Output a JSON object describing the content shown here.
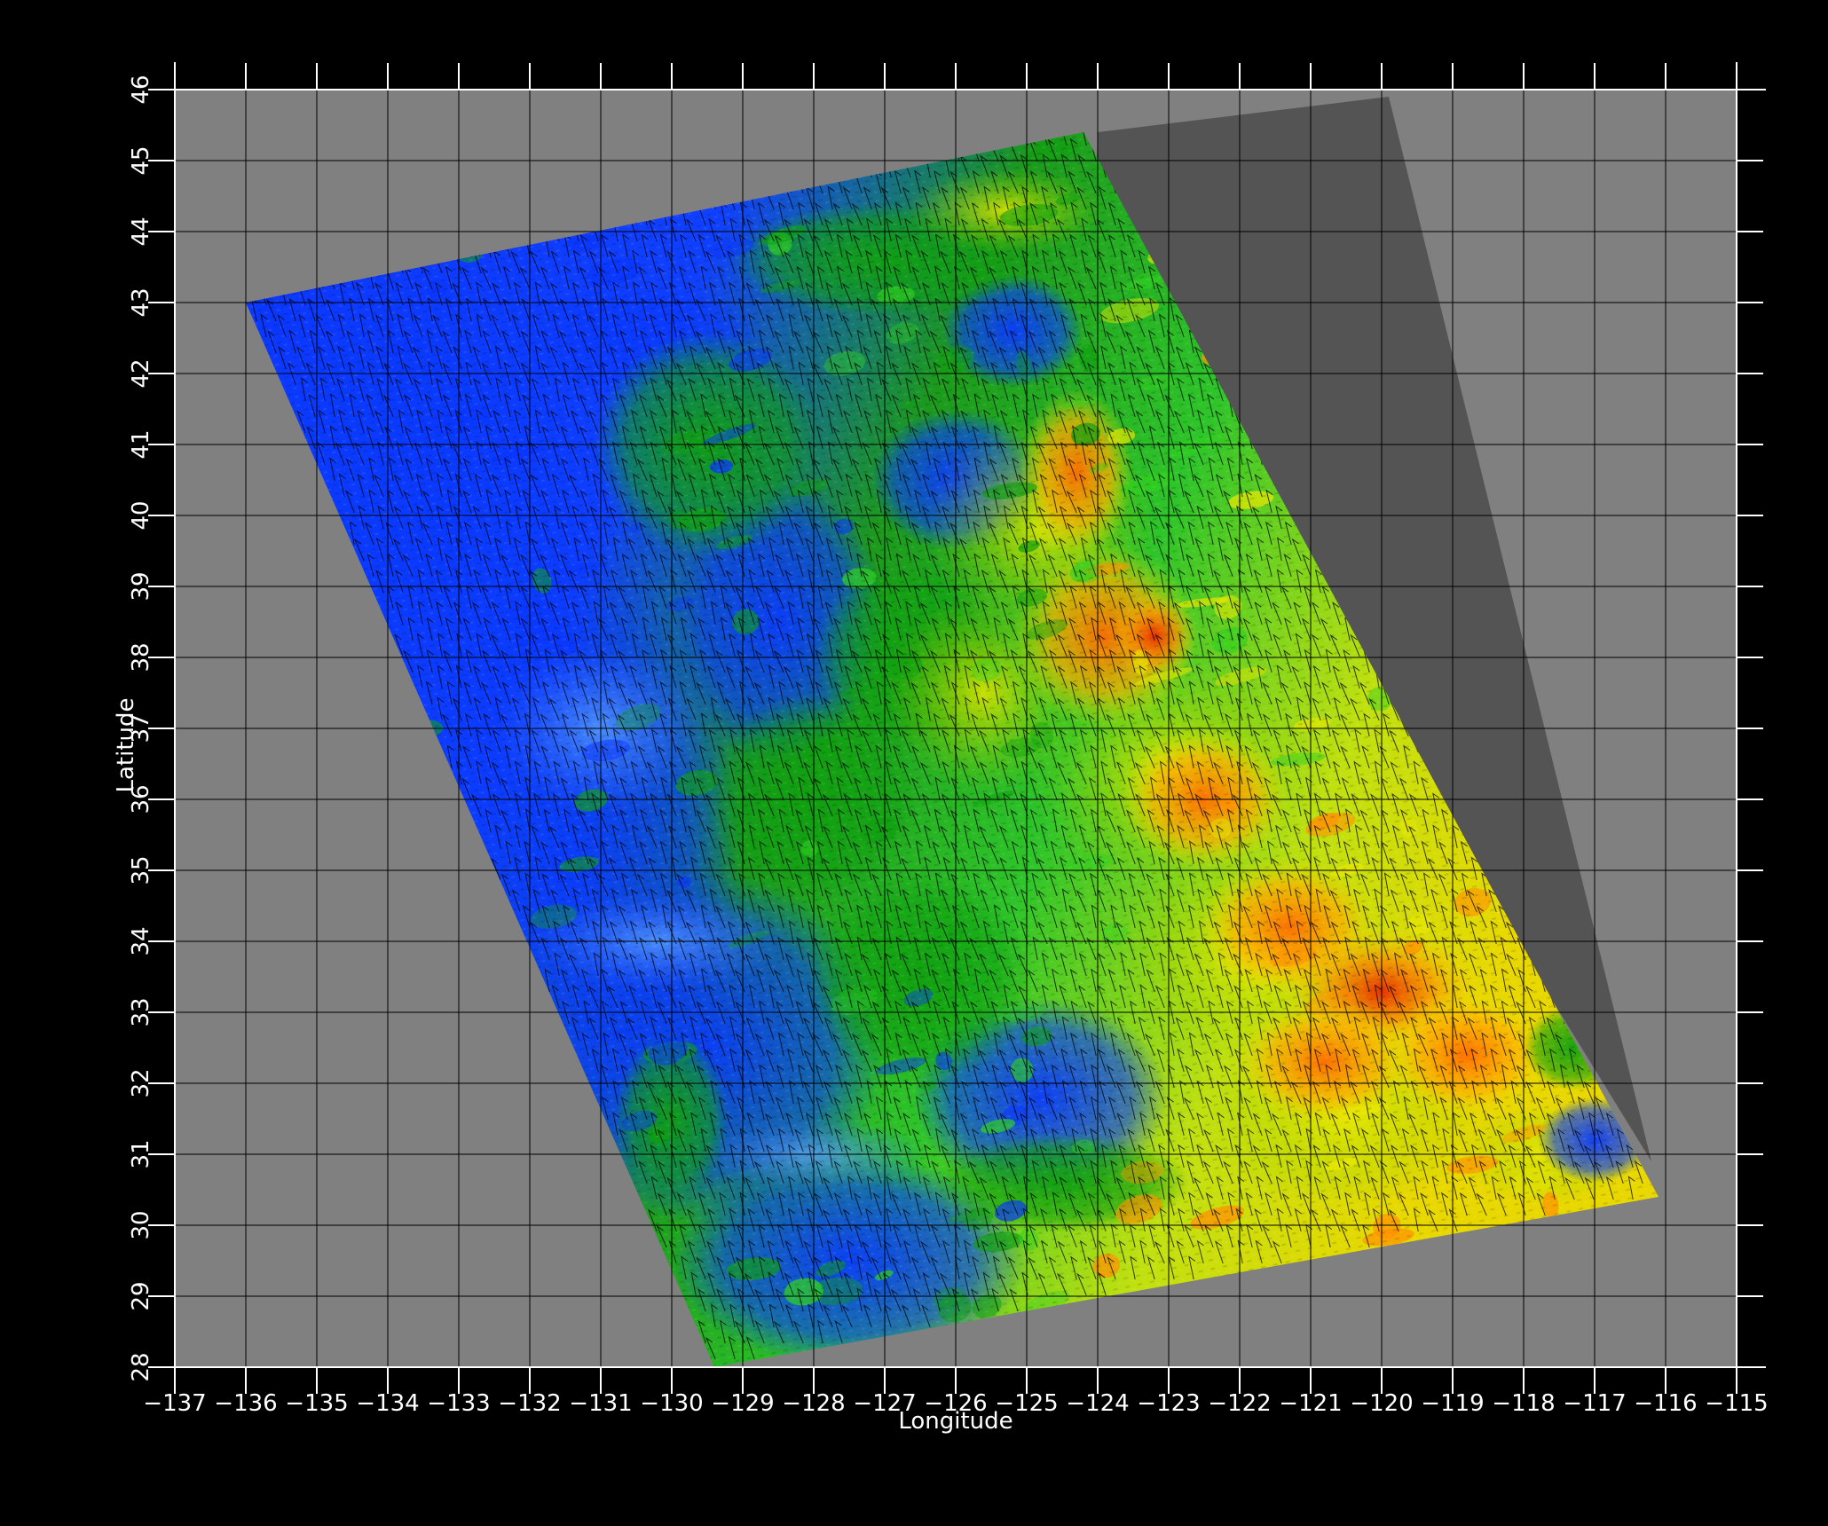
{
  "map": {
    "xlabel": "Longitude",
    "ylabel": "Latitude",
    "x_ticks": [
      "−137",
      "−136",
      "−135",
      "−134",
      "−133",
      "−132",
      "−131",
      "−130",
      "−129",
      "−128",
      "−127",
      "−126",
      "−125",
      "−124",
      "−123",
      "−122",
      "−121",
      "−120",
      "−119",
      "−118",
      "−117",
      "−116",
      "−115"
    ],
    "y_ticks": [
      "28",
      "29",
      "30",
      "31",
      "32",
      "33",
      "34",
      "35",
      "36",
      "37",
      "38",
      "39",
      "40",
      "41",
      "42",
      "43",
      "44",
      "45",
      "46"
    ],
    "extent": {
      "lon": [
        -137,
        -115
      ],
      "lat": [
        28,
        46
      ]
    },
    "swath": [
      [
        -136,
        43.0
      ],
      [
        -124.2,
        45.4
      ],
      [
        -116.1,
        30.4
      ],
      [
        -129.4,
        28.0
      ]
    ],
    "land_region": [
      [
        -124.0,
        45.4
      ],
      [
        -119.9,
        45.9
      ],
      [
        -116.2,
        30.9
      ],
      [
        -117.8,
        33.5
      ],
      [
        -119.0,
        34.4
      ],
      [
        -121.0,
        35.5
      ],
      [
        -122.4,
        37.2
      ],
      [
        -123.3,
        38.6
      ],
      [
        -123.8,
        40.2
      ],
      [
        -124.1,
        42.2
      ],
      [
        -124.0,
        45.4
      ]
    ],
    "colors": {
      "background": "#000000",
      "no_data": "#808080",
      "land": "#545454",
      "scale": [
        "#0030ff",
        "#4a90ff",
        "#00a000",
        "#30e020",
        "#e8e800",
        "#ff9a00",
        "#e82000"
      ]
    }
  }
}
